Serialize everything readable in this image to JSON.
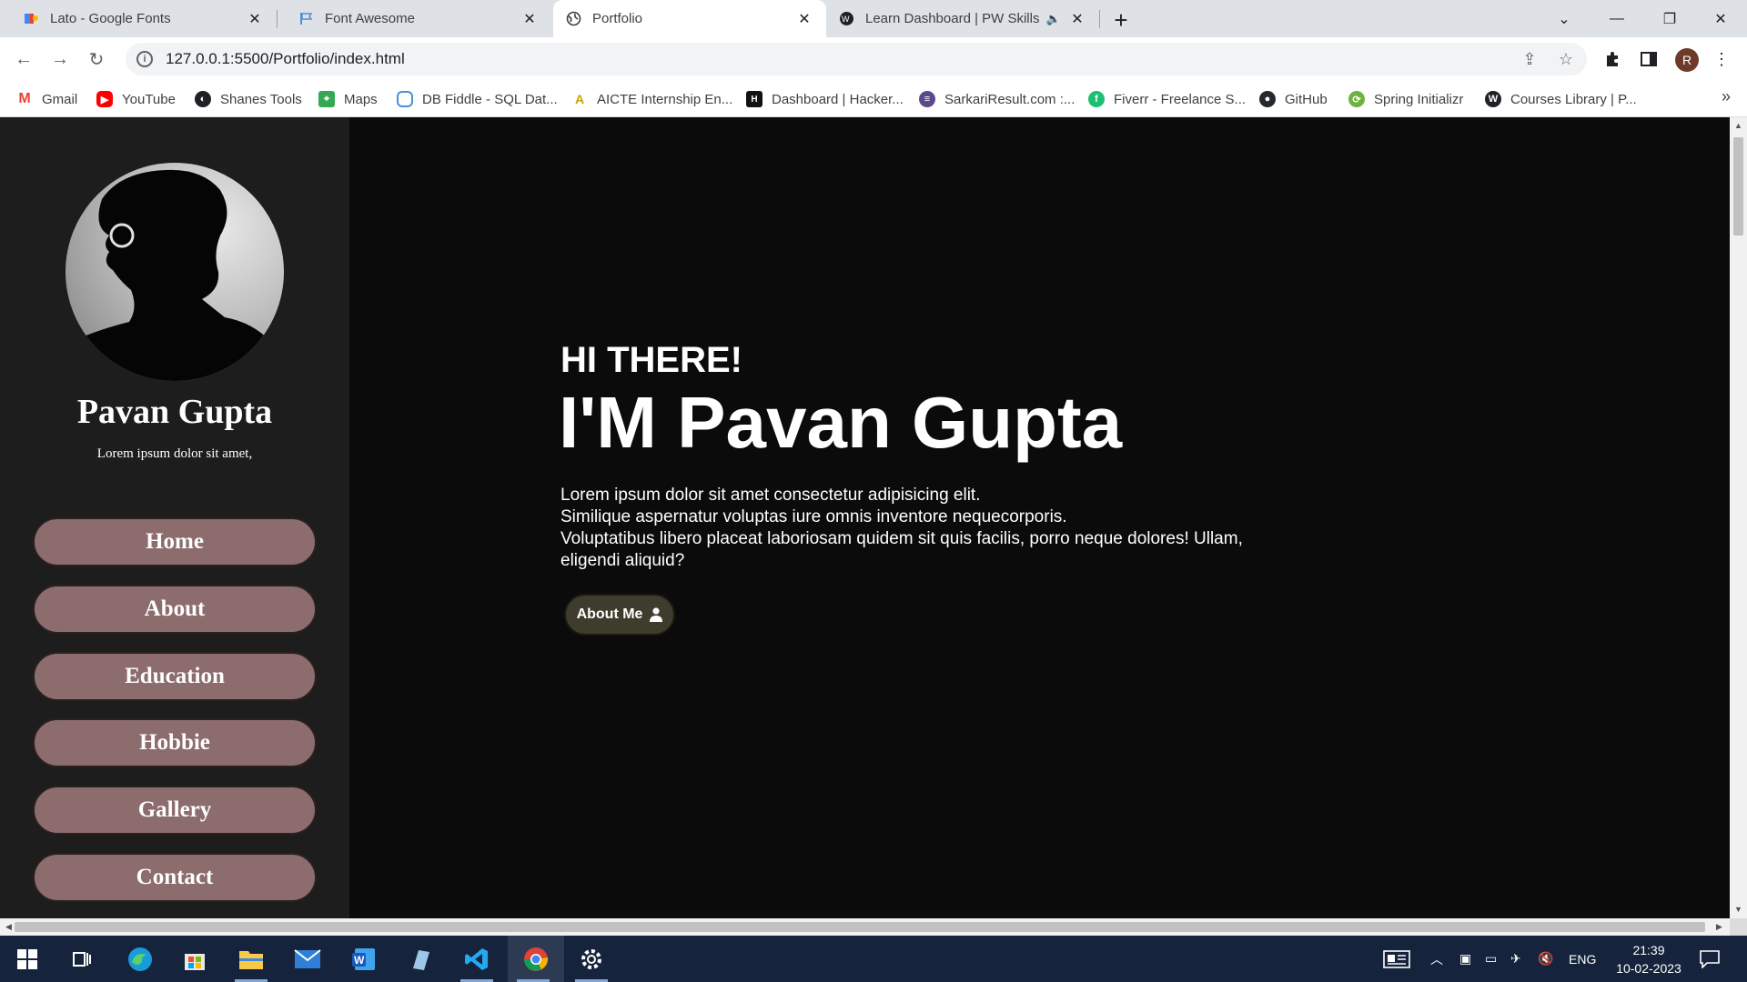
{
  "browser": {
    "tabs": [
      {
        "title": "Lato - Google Fonts",
        "icon": "google-fonts-icon"
      },
      {
        "title": "Font Awesome",
        "icon": "font-awesome-icon"
      },
      {
        "title": "Portfolio",
        "icon": "globe-icon",
        "active": true
      },
      {
        "title": "Learn Dashboard | PW Skills",
        "icon": "pw-skills-icon",
        "muted_audio": true
      }
    ],
    "url": "127.0.0.1:5500/Portfolio/index.html",
    "profile_initial": "R",
    "bookmarks": [
      {
        "label": "Gmail",
        "icon": "gmail-icon",
        "color": "#ea4335"
      },
      {
        "label": "YouTube",
        "icon": "youtube-icon",
        "color": "#ff0000"
      },
      {
        "label": "Shanes Tools",
        "icon": "shanes-tools-icon",
        "color": "#202124"
      },
      {
        "label": "Maps",
        "icon": "maps-icon",
        "color": "#34a853"
      },
      {
        "label": "DB Fiddle - SQL Dat...",
        "icon": "db-fiddle-icon",
        "color": "#4a90d9"
      },
      {
        "label": "AICTE Internship En...",
        "icon": "aicte-icon",
        "color": "#c9a400"
      },
      {
        "label": "Dashboard | Hacker...",
        "icon": "hackerrank-icon",
        "color": "#111111"
      },
      {
        "label": "SarkariResult.com :...",
        "icon": "sarkari-result-icon",
        "color": "#5b4a8a"
      },
      {
        "label": "Fiverr - Freelance S...",
        "icon": "fiverr-icon",
        "color": "#1dbf73"
      },
      {
        "label": "GitHub",
        "icon": "github-icon",
        "color": "#24292f"
      },
      {
        "label": "Spring Initializr",
        "icon": "spring-icon",
        "color": "#6db33f"
      },
      {
        "label": "Courses Library | P...",
        "icon": "courses-library-icon",
        "color": "#202124"
      }
    ]
  },
  "sidebar": {
    "name": "Pavan Gupta",
    "tagline": "Lorem ipsum dolor sit amet,",
    "nav": [
      {
        "label": "Home"
      },
      {
        "label": "About"
      },
      {
        "label": "Education"
      },
      {
        "label": "Hobbie"
      },
      {
        "label": "Gallery"
      },
      {
        "label": "Contact"
      }
    ]
  },
  "hero": {
    "greeting": "HI THERE!",
    "headline": "I'M Pavan Gupta",
    "description_lines": [
      "Lorem ipsum dolor sit amet consectetur adipisicing elit.",
      "Similique aspernatur voluptas iure omnis inventore nequecorporis.",
      "Voluptatibus libero placeat laboriosam quidem sit quis facilis, porro neque dolores! Ullam, eligendi aliquid?"
    ],
    "button_label": "About Me"
  },
  "taskbar": {
    "apps": [
      "windows-start-icon",
      "task-view-icon",
      "edge-icon",
      "store-icon",
      "file-explorer-icon",
      "mail-icon",
      "word-icon",
      "app-icon",
      "vscode-icon",
      "chrome-icon",
      "settings-icon"
    ],
    "language": "ENG",
    "time": "21:39",
    "date": "10-02-2023"
  },
  "colors": {
    "sidebar_bg": "#1d1d1d",
    "main_bg": "#0b0b0b",
    "nav_button": "#8c6c6c",
    "about_button": "#3e3c2c"
  }
}
